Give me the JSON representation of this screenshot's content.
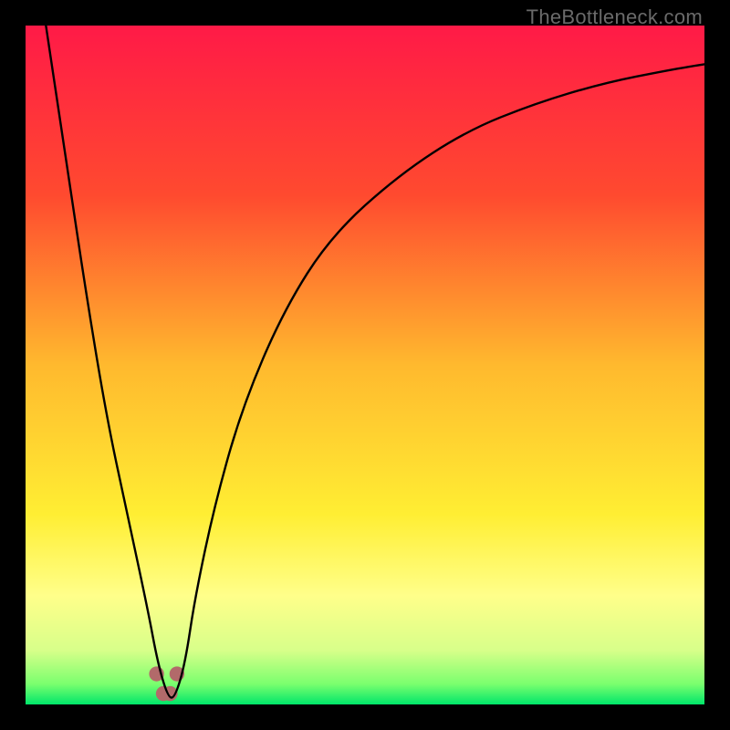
{
  "watermark": "TheBottleneck.com",
  "chart_data": {
    "type": "line",
    "title": "",
    "xlabel": "",
    "ylabel": "",
    "xlim": [
      0,
      100
    ],
    "ylim": [
      0,
      100
    ],
    "axes_color": "#000000",
    "background_gradient": {
      "stops": [
        {
          "pos": 0.0,
          "color": "#ff1a47"
        },
        {
          "pos": 0.25,
          "color": "#ff4a2f"
        },
        {
          "pos": 0.5,
          "color": "#ffb92e"
        },
        {
          "pos": 0.72,
          "color": "#ffee33"
        },
        {
          "pos": 0.84,
          "color": "#ffff8a"
        },
        {
          "pos": 0.92,
          "color": "#d8ff8a"
        },
        {
          "pos": 0.97,
          "color": "#7aff6e"
        },
        {
          "pos": 1.0,
          "color": "#00e66a"
        }
      ]
    },
    "series": [
      {
        "name": "bottleneck-curve",
        "x": [
          3,
          6,
          9,
          12,
          15,
          18,
          19.5,
          21,
          22,
          23.5,
          25,
          28,
          32,
          38,
          45,
          55,
          65,
          75,
          85,
          95,
          100
        ],
        "values": [
          100,
          80,
          60,
          42,
          28,
          14,
          6,
          1,
          1,
          6,
          16,
          30,
          44,
          58,
          69,
          78,
          84.5,
          88.5,
          91.5,
          93.5,
          94.3
        ]
      }
    ],
    "markers": {
      "name": "highlight-markers",
      "color": "#b26a6a",
      "points": [
        {
          "x": 19.3,
          "y": 4.5
        },
        {
          "x": 20.3,
          "y": 1.6
        },
        {
          "x": 21.3,
          "y": 1.6
        },
        {
          "x": 22.3,
          "y": 4.5
        }
      ],
      "radius_pct": 1.1
    }
  }
}
